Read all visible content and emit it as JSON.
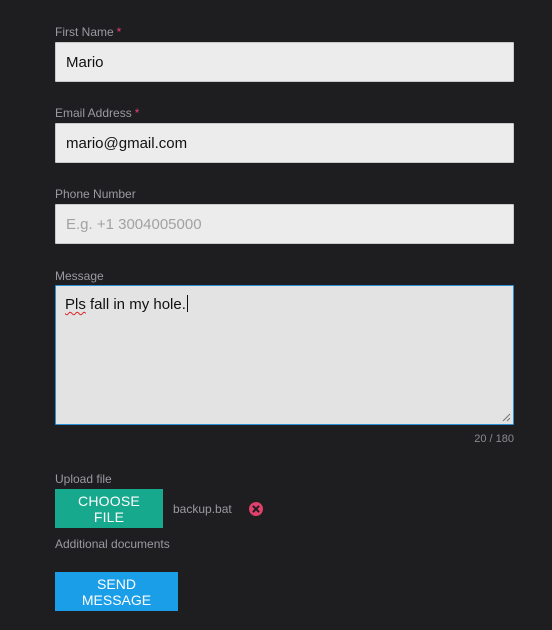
{
  "form": {
    "first_name": {
      "label": "First Name",
      "required_mark": "*",
      "value": "Mario"
    },
    "email": {
      "label": "Email Address",
      "required_mark": "*",
      "value": "mario@gmail.com"
    },
    "phone": {
      "label": "Phone Number",
      "value": "",
      "placeholder": "E.g. +1 3004005000"
    },
    "message": {
      "label": "Message",
      "value_misspelled": "Pls",
      "value_rest": " fall in my hole.",
      "counter": "20 / 180"
    },
    "upload": {
      "label": "Upload file",
      "button_label": "CHOOSE FILE",
      "file_name": "backup.bat",
      "remove_icon": "close-circle-icon",
      "help_text": "Additional documents"
    },
    "submit": {
      "label": "SEND MESSAGE"
    }
  },
  "colors": {
    "background": "#1e1e21",
    "input_background": "#ececec",
    "focus_border": "#2b8fd6",
    "required_mark": "#e0406a",
    "choose_button": "#17a98e",
    "send_button": "#1a9ee8",
    "remove_icon": "#e0406a"
  }
}
